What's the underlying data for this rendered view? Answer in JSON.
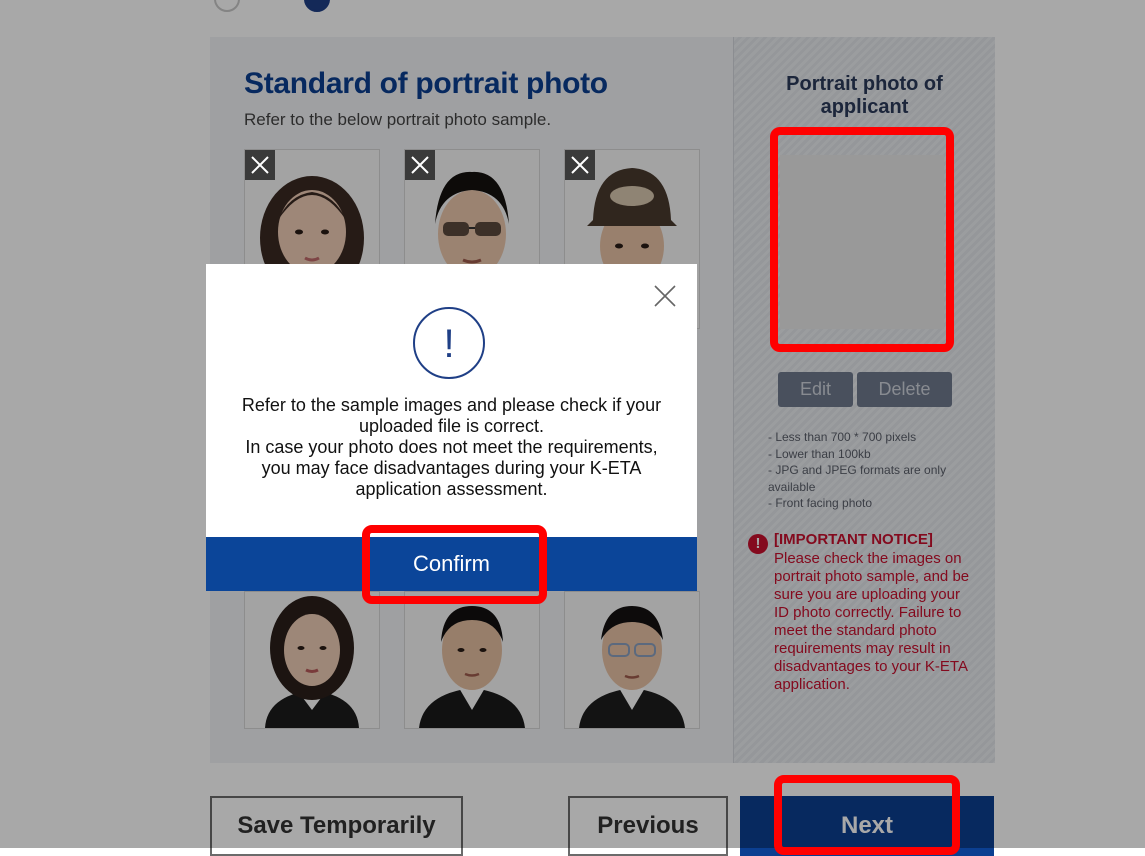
{
  "left_panel": {
    "title": "Standard of portrait photo",
    "subtitle": "Refer to the below portrait photo sample."
  },
  "right_panel": {
    "title_line1": "Portrait photo of",
    "title_line2": "applicant",
    "edit_label": "Edit",
    "delete_label": "Delete",
    "requirements": [
      "- Less than 700 * 700 pixels",
      "- Lower than 100kb",
      "- JPG and JPEG formats are only",
      "available",
      "- Front facing photo"
    ],
    "notice_title": "[IMPORTANT NOTICE]",
    "notice_body": "Please check the images on portrait photo sample, and be sure you are uploading your ID photo correctly. Failure to meet the standard photo requirements may result in disadvantages to your K-ETA application."
  },
  "buttons": {
    "save_temp": "Save Temporarily",
    "previous": "Previous",
    "next": "Next"
  },
  "modal": {
    "icon_glyph": "!",
    "message_lines": [
      "Refer to the sample images and please check if your",
      "uploaded file is correct.",
      "In case your photo does not meet the requirements,",
      "you may face disadvantages during your K-ETA",
      "application assessment."
    ],
    "confirm_label": "Confirm"
  },
  "icons": {
    "close": "close-icon",
    "wrong_mark": "x-mark-icon",
    "alert": "exclamation-icon",
    "notice": "warning-icon"
  },
  "colors": {
    "brand_blue": "#0b3f91",
    "notice_red": "#c8102e",
    "highlight_red": "#ff0000"
  }
}
